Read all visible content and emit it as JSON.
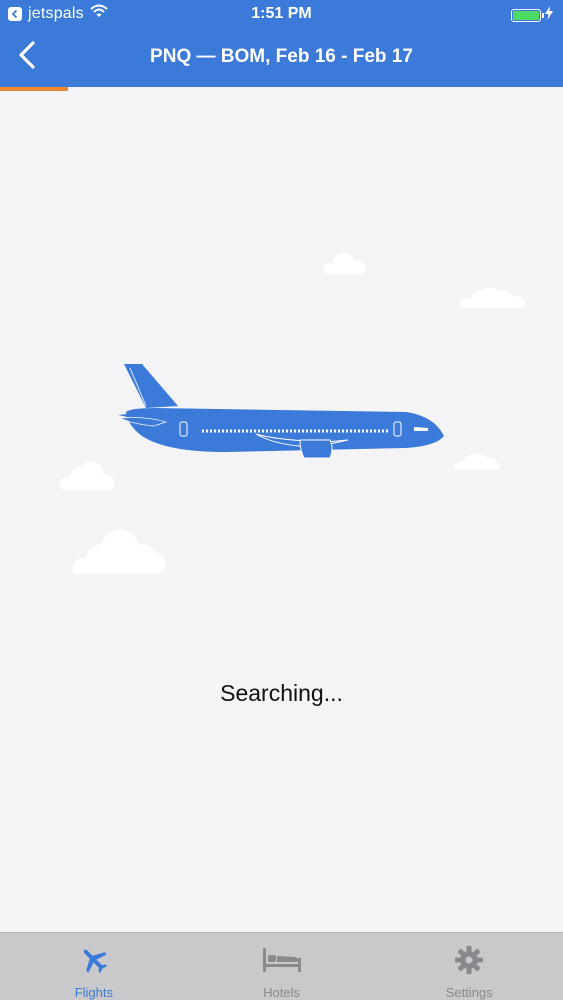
{
  "status_bar": {
    "carrier": "jetspals",
    "time": "1:51 PM",
    "battery_percent": 100
  },
  "nav": {
    "title": "PNQ — BOM, Feb 16 - Feb 17",
    "back_icon": "chevron-left-icon"
  },
  "search": {
    "progress_percent": 12,
    "status_text": "Searching..."
  },
  "tabs": [
    {
      "label": "Flights",
      "icon": "airplane-icon",
      "active": true
    },
    {
      "label": "Hotels",
      "icon": "bed-icon",
      "active": false
    },
    {
      "label": "Settings",
      "icon": "gear-icon",
      "active": false
    }
  ],
  "colors": {
    "header": "#3b7ad8",
    "accent": "#f0872c",
    "airplane": "#3b7ad8",
    "tab_active": "#3b7ad8",
    "tab_inactive": "#8a8a8e"
  }
}
